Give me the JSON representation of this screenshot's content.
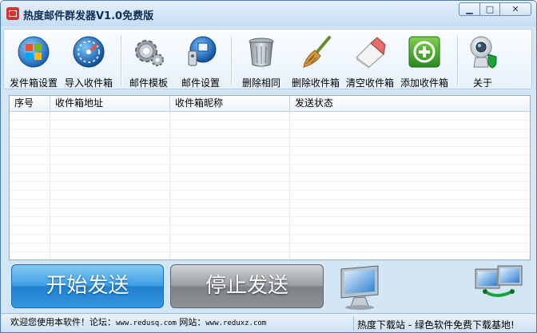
{
  "window": {
    "title": "热度邮件群发器V1.0免费版",
    "controls": {
      "minimize": "▁",
      "maximize": "□",
      "close": "✕"
    }
  },
  "toolbar": {
    "items": [
      {
        "label": "发件箱设置",
        "icon": "windows-globe-icon"
      },
      {
        "label": "导入收件箱",
        "icon": "gauge-globe-icon"
      },
      {
        "label": "邮件模板",
        "icon": "gears-icon"
      },
      {
        "label": "邮件设置",
        "icon": "network-settings-icon"
      },
      {
        "label": "删除相同",
        "icon": "trash-bin-icon"
      },
      {
        "label": "删除收件箱",
        "icon": "broom-icon"
      },
      {
        "label": "清空收件箱",
        "icon": "eraser-icon"
      },
      {
        "label": "添加收件箱",
        "icon": "add-icon"
      },
      {
        "label": "关于",
        "icon": "webcam-shield-icon"
      }
    ]
  },
  "table": {
    "columns": [
      "序号",
      "收件箱地址",
      "收件箱昵称",
      "发送状态"
    ],
    "rows": []
  },
  "actions": {
    "start": "开始发送",
    "stop": "停止发送"
  },
  "status": {
    "welcome": "欢迎您使用本软件！论坛：",
    "forum_url": "www.redusq.com",
    "site_label": " 网站：",
    "site_url": "www.reduxz.com",
    "right_text": "热度下载站 - 绿色软件免费下载基地!"
  },
  "colors": {
    "accent": "#1f80cf",
    "titlebar": "#c6dcf2",
    "stop_button": "#8f9499"
  }
}
